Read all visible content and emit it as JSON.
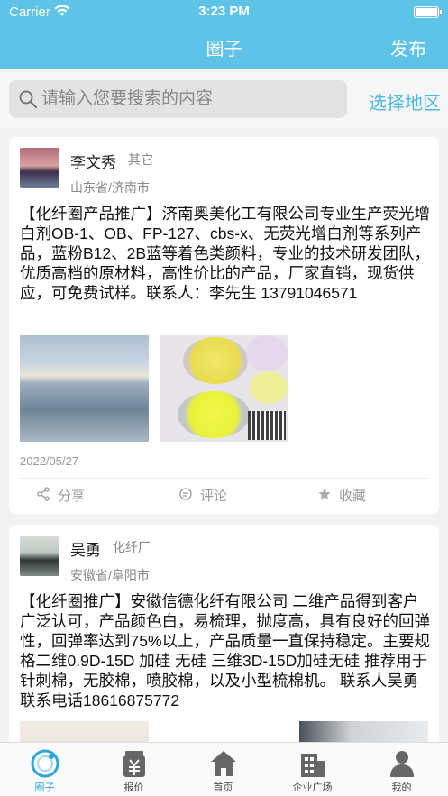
{
  "status": {
    "carrier": "Carrier",
    "time": "3:23 PM"
  },
  "nav": {
    "title": "圈子",
    "publish": "发布"
  },
  "search": {
    "placeholder": "请输入您要搜索的内容",
    "region": "选择地区"
  },
  "posts": [
    {
      "name": "李文秀",
      "tag": "其它",
      "location": "山东省/济南市",
      "text": "【化纤圈产品推广】济南奥美化工有限公司专业生产荧光增白剂OB-1、OB、FP-127、cbs-x、无荧光增白剂等系列产品，蓝粉B12、2B蓝等着色类颜料，专业的技术研发团队，优质高档的原材料，高性价比的产品，厂家直销，现货供应，可免费试样。联系人：李先生        13791046571",
      "date": "2022/05/27",
      "share": "分享",
      "comment": "评论",
      "favorite": "收藏"
    },
    {
      "name": "吴勇",
      "tag": "化纤厂",
      "location": "安徽省/阜阳市",
      "text": "【化纤圈推广】安徽信德化纤有限公司 二维产品得到客户广泛认可，产品颜色白，易梳理，抛度高，具有良好的回弹性，回弹率达到75%以上，产品质量一直保持稳定。主要规格二维0.9D-15D 加硅 无硅 三维3D-15D加硅无硅 推荐用于针刺棉，无胶棉，喷胶棉，以及小型梳棉机。 联系人吴勇联系电话18616875772"
    }
  ],
  "tabs": [
    {
      "label": "圈子",
      "icon": "circle-icon"
    },
    {
      "label": "报价",
      "icon": "price-tag-icon"
    },
    {
      "label": "首页",
      "icon": "home-icon"
    },
    {
      "label": "企业广场",
      "icon": "building-icon"
    },
    {
      "label": "我的",
      "icon": "person-icon"
    }
  ],
  "colors": {
    "primary": "#5ec3e6",
    "accent": "#4db8e2",
    "active_tab": "#2fa6d6"
  }
}
